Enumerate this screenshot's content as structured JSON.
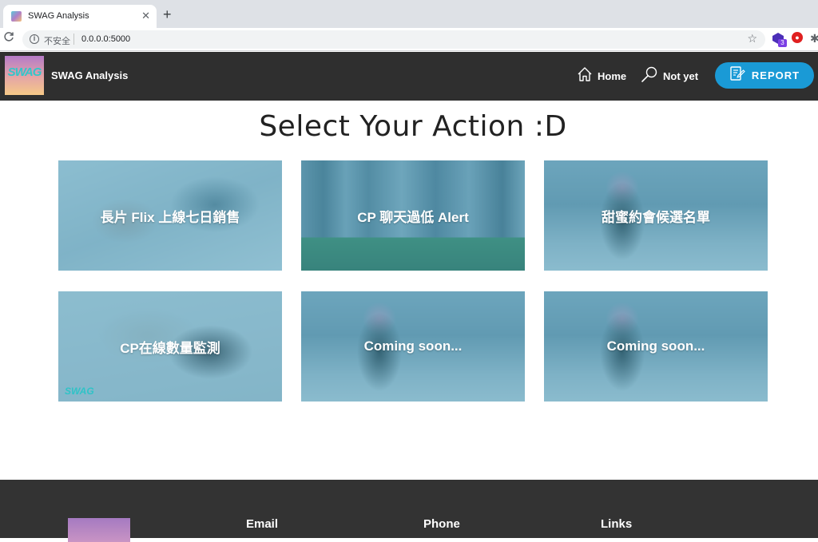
{
  "browser": {
    "tab_title": "SWAG Analysis",
    "tab_close": "✕",
    "new_tab": "+",
    "security_label": "不安全",
    "url": "0.0.0.0:5000",
    "extension_badge": "3"
  },
  "header": {
    "logo_text": "SWAG",
    "brand": "SWAG Analysis",
    "nav": {
      "home_label": "Home",
      "notyet_label": "Not yet"
    },
    "report_label": "REPORT"
  },
  "main": {
    "title": "Select Your Action :D",
    "cards": [
      {
        "label": "長片 Flix 上線七日銷售"
      },
      {
        "label": "CP 聊天過低 Alert"
      },
      {
        "label": "甜蜜約會候選名單"
      },
      {
        "label": "CP在線數量監測",
        "watermark": "SWAG"
      },
      {
        "label": "Coming soon..."
      },
      {
        "label": "Coming soon..."
      }
    ]
  },
  "footer": {
    "email_heading": "Email",
    "phone_heading": "Phone",
    "links_heading": "Links"
  },
  "colors": {
    "header_bg": "#2f2f2f",
    "report_button": "#1a9ad6",
    "card_overlay": "#4096b4",
    "footer_bg": "#333333"
  },
  "icons": {
    "home": "home-icon",
    "search": "search-icon",
    "report": "report-edit-icon"
  }
}
